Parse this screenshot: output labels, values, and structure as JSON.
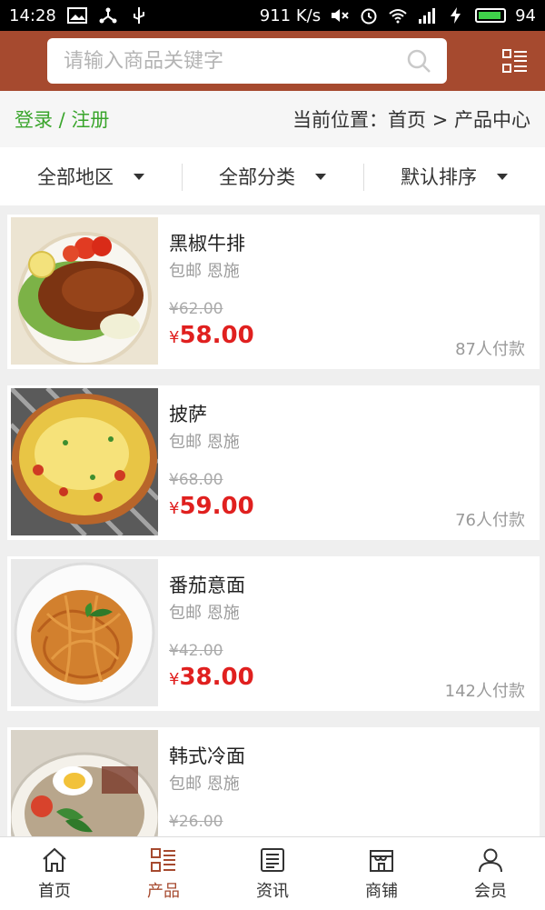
{
  "status_bar": {
    "time": "14:28",
    "speed": "911 K/s",
    "battery": "94"
  },
  "header": {
    "search_placeholder": "请输入商品关键字"
  },
  "location_bar": {
    "login_label": "登录 / 注册",
    "breadcrumb": "当前位置：首页 > 产品中心"
  },
  "filters": [
    {
      "label": "全部地区"
    },
    {
      "label": "全部分类"
    },
    {
      "label": "默认排序"
    }
  ],
  "products": [
    {
      "name": "黑椒牛排",
      "shipping": "包邮 恩施",
      "original_price": "¥62.00",
      "currency": "¥",
      "price": "58.00",
      "paid": "87人付款",
      "image": "steak-photo"
    },
    {
      "name": "披萨",
      "shipping": "包邮 恩施",
      "original_price": "¥68.00",
      "currency": "¥",
      "price": "59.00",
      "paid": "76人付款",
      "image": "pizza-photo"
    },
    {
      "name": "番茄意面",
      "shipping": "包邮 恩施",
      "original_price": "¥42.00",
      "currency": "¥",
      "price": "38.00",
      "paid": "142人付款",
      "image": "pasta-photo"
    },
    {
      "name": "韩式冷面",
      "shipping": "包邮 恩施",
      "original_price": "¥26.00",
      "currency": "¥",
      "price": "",
      "paid": "",
      "image": "cold-noodle-photo"
    }
  ],
  "tabbar": [
    {
      "label": "首页",
      "icon": "home-icon"
    },
    {
      "label": "产品",
      "icon": "list-icon",
      "active": true
    },
    {
      "label": "资讯",
      "icon": "news-icon"
    },
    {
      "label": "商铺",
      "icon": "store-icon"
    },
    {
      "label": "会员",
      "icon": "user-icon"
    }
  ],
  "colors": {
    "brand": "#a64a2f",
    "price": "#e0201f",
    "login": "#3aa52c"
  }
}
